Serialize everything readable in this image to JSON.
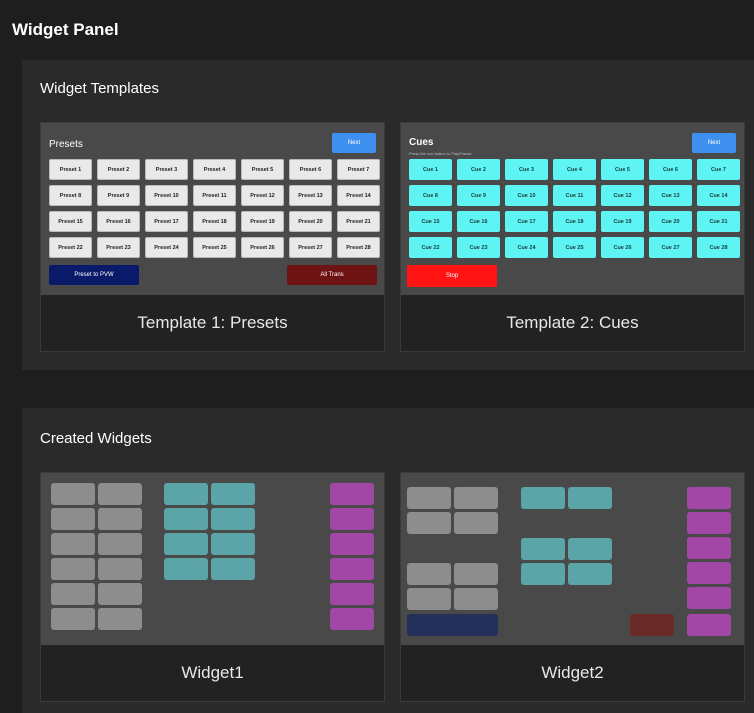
{
  "page_title": "Widget Panel",
  "templates_section": {
    "title": "Widget Templates",
    "template1": {
      "label": "Template 1: Presets",
      "preview_title": "Presets",
      "next": "Next",
      "buttons": [
        "Preset 1",
        "Preset 2",
        "Preset 3",
        "Preset 4",
        "Preset 5",
        "Preset 6",
        "Preset 7",
        "Preset 8",
        "Preset 9",
        "Preset 10",
        "Preset 11",
        "Preset 12",
        "Preset 13",
        "Preset 14",
        "Preset 15",
        "Preset 16",
        "Preset 17",
        "Preset 18",
        "Preset 19",
        "Preset 20",
        "Preset 21",
        "Preset 22",
        "Preset 23",
        "Preset 24",
        "Preset 25",
        "Preset 26",
        "Preset 27",
        "Preset 28"
      ],
      "preset_to_pvw": "Preset to PVW",
      "all_trans": "All Trans"
    },
    "template2": {
      "label": "Template 2: Cues",
      "preview_title": "Cues",
      "preview_subtitle": "Press the cue button to Play/Pause",
      "next": "Next",
      "buttons": [
        "Cue 1",
        "Cue 2",
        "Cue 3",
        "Cue 4",
        "Cue 5",
        "Cue 6",
        "Cue 7",
        "Cue 8",
        "Cue 9",
        "Cue 10",
        "Cue 11",
        "Cue 12",
        "Cue 13",
        "Cue 14",
        "Cue 15",
        "Cue 16",
        "Cue 17",
        "Cue 18",
        "Cue 19",
        "Cue 20",
        "Cue 21",
        "Cue 22",
        "Cue 23",
        "Cue 24",
        "Cue 25",
        "Cue 26",
        "Cue 27",
        "Cue 28"
      ],
      "stop": "Stop"
    }
  },
  "created_section": {
    "title": "Created Widgets",
    "widgets": [
      {
        "label": "Widget1"
      },
      {
        "label": "Widget2"
      }
    ]
  },
  "colors": {
    "gray_block": "#8d8d8d",
    "teal_block": "#5ba5a8",
    "magenta_block": "#a347a6",
    "navy_block": "#24305a",
    "maroon_block": "#6a2a28",
    "next_blue": "#3d8ff0",
    "cue_cyan": "#5ef4f4",
    "stop_red": "#ff1313"
  }
}
